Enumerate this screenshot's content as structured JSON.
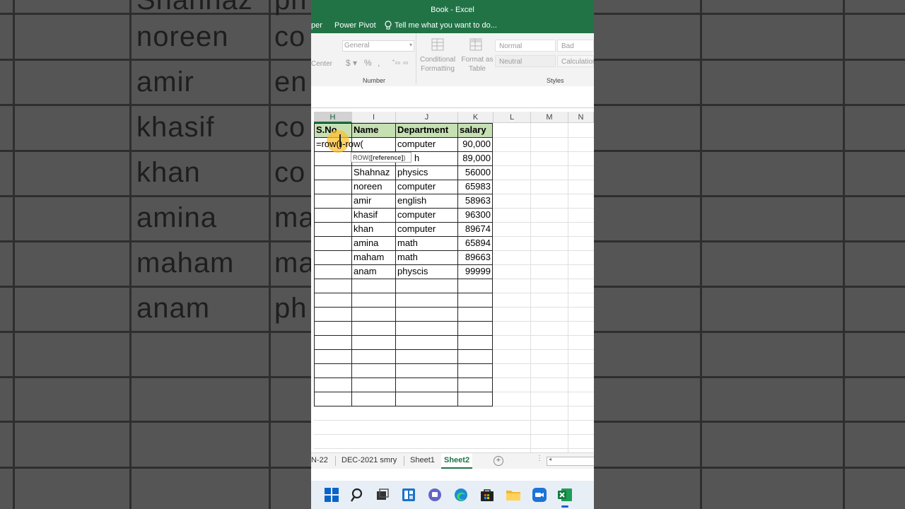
{
  "window": {
    "title": "Book - Excel"
  },
  "ribbon_tabs": [
    "per",
    "Power Pivot"
  ],
  "tell_me": "Tell me what you want to do...",
  "ribbon": {
    "alignment_partial": "Center",
    "number_format": "General",
    "number_group_label": "Number",
    "conditional_formatting": [
      "Conditional",
      "Formatting"
    ],
    "format_as_table": [
      "Format as",
      "Table"
    ],
    "styles": {
      "normal": "Normal",
      "bad": "Bad",
      "neutral": "Neutral",
      "calculation": "Calculation"
    },
    "styles_group_label": "Styles"
  },
  "columns": [
    "H",
    "I",
    "J",
    "K",
    "L",
    "M",
    "N"
  ],
  "table": {
    "headers": [
      "S.No",
      "Name",
      "Department",
      "salary"
    ],
    "editing_formula": "=row()-row(",
    "row1": [
      "computer",
      "90,000"
    ],
    "row2_partial_dept": "h",
    "row2_salary": "89,000",
    "rows": [
      {
        "name": "Shahnaz",
        "dept": "physics",
        "salary": "56000"
      },
      {
        "name": "noreen",
        "dept": "computer",
        "salary": "65983"
      },
      {
        "name": "amir",
        "dept": "english",
        "salary": "58963"
      },
      {
        "name": "khasif",
        "dept": "computer",
        "salary": "96300"
      },
      {
        "name": "khan",
        "dept": "computer",
        "salary": "89674"
      },
      {
        "name": "amina",
        "dept": "math",
        "salary": "65894"
      },
      {
        "name": "maham",
        "dept": "math",
        "salary": "89663"
      },
      {
        "name": "anam",
        "dept": "physcis",
        "salary": "99999"
      }
    ]
  },
  "tooltip": {
    "prefix": "ROW(",
    "arg": "[reference]",
    "suffix": ")"
  },
  "sheet_tabs": [
    "N-22",
    "DEC-2021 smry",
    "Sheet1",
    "Sheet2"
  ],
  "active_sheet": "Sheet2",
  "background_text": {
    "names": [
      "Shahnaz",
      "noreen",
      "amir",
      "khasif",
      "khan",
      "amina",
      "maham",
      "anam"
    ],
    "dept_fragments": [
      "ph",
      "co",
      "en",
      "co",
      "co",
      "ma",
      "ma",
      "ph"
    ]
  },
  "colors": {
    "excel_green": "#217346",
    "header_fill": "#c6e0b4",
    "cursor_highlight": "#ffbe28"
  }
}
